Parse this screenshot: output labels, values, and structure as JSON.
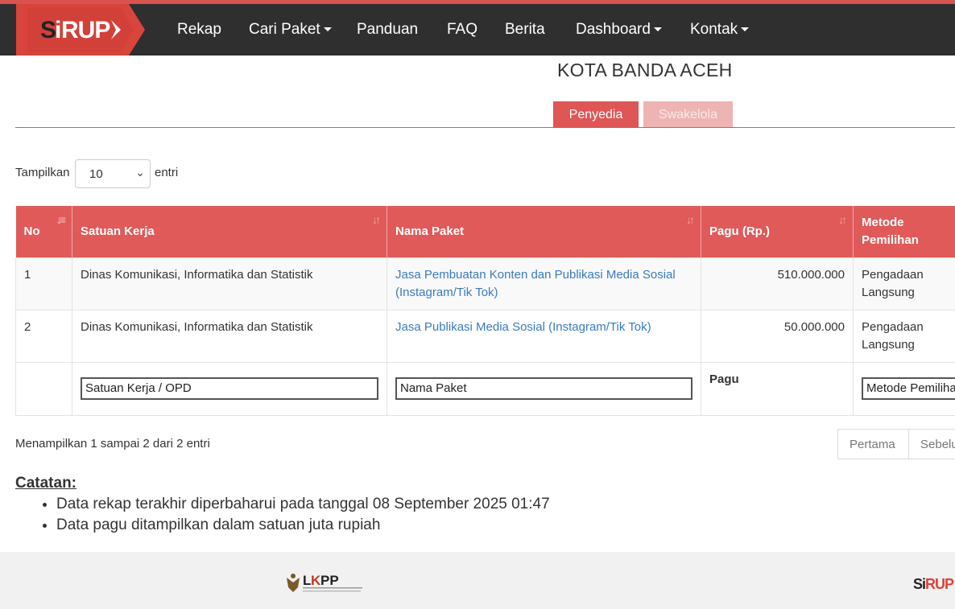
{
  "nav": {
    "logo_text": "SiRUP",
    "items": [
      {
        "label": "Rekap",
        "dropdown": false
      },
      {
        "label": "Cari Paket",
        "dropdown": true
      },
      {
        "label": "Panduan",
        "dropdown": false
      },
      {
        "label": "FAQ",
        "dropdown": false
      },
      {
        "label": "Berita",
        "dropdown": false
      },
      {
        "label": "Dashboard",
        "dropdown": true
      },
      {
        "label": "Kontak",
        "dropdown": true
      }
    ]
  },
  "page_title": "KOTA BANDA ACEH",
  "tabs": [
    {
      "label": "Penyedia",
      "active": true
    },
    {
      "label": "Swakelola",
      "active": false
    }
  ],
  "length_menu": {
    "prefix": "Tampilkan",
    "value": "10",
    "suffix": "entri"
  },
  "table": {
    "headers": [
      "No",
      "Satuan Kerja",
      "Nama Paket",
      "Pagu (Rp.)",
      "Metode Pemilihan"
    ],
    "rows": [
      {
        "no": "1",
        "satker": "Dinas Komunikasi, Informatika dan Statistik",
        "paket": "Jasa Pembuatan Konten dan Publikasi Media Sosial (Instagram/Tik Tok)",
        "pagu": "510.000.000",
        "metode": "Pengadaan Langsung"
      },
      {
        "no": "2",
        "satker": "Dinas Komunikasi, Informatika dan Statistik",
        "paket": "Jasa Publikasi Media Sosial (Instagram/Tik Tok)",
        "pagu": "50.000.000",
        "metode": "Pengadaan Langsung"
      }
    ],
    "filters": {
      "satker": "Satuan Kerja / OPD",
      "paket": "Nama Paket",
      "pagu": "Pagu",
      "metode": "Metode Pemilihan"
    }
  },
  "info": "Menampilkan 1 sampai 2 dari 2 entri",
  "pagination": {
    "first": "Pertama",
    "prev": "Sebelumnya"
  },
  "notes": {
    "title": "Catatan:",
    "items": [
      "Data rekap terakhir diperbaharui pada tanggal 08 September 2025 01:47",
      "Data pagu ditampilkan dalam satuan juta rupiah"
    ]
  },
  "footer": {
    "lkpp_text": "LKPP",
    "lkpp_sub": "Lembaga Kebijakan Pengadaan Barang/Jasa Pemerintah",
    "sirup_text": "SiRUP"
  },
  "colors": {
    "brand_red": "#de5656",
    "navbar": "#2f2f2f",
    "link": "#3a7bbf"
  }
}
